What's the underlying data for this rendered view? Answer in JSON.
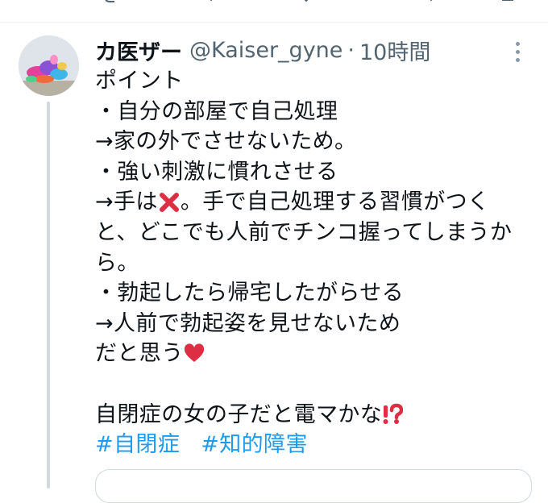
{
  "tweet": {
    "display_name": "カ医ザー",
    "handle": "@Kaiser_gyne",
    "separator": "·",
    "time": "10時間",
    "lines": {
      "l1": "ポイント",
      "l2": "・自分の部屋で自己処理",
      "l3": "→家の外でさせないため。",
      "l4": "・強い刺激に慣れさせる",
      "l5a": "→手は",
      "l5b": "。手で自己処理する習慣がつく",
      "l6": "と、どこでも人前でチンコ握ってしまうか",
      "l7": "ら。",
      "l8": "・勃起したら帰宅したがらせる",
      "l9": "→人前で勃起姿を見せないため",
      "l10": "だと思う",
      "l12": "自閉症の女の子だと電マかな"
    },
    "hashtags": [
      "#自閉症",
      "#知的障害"
    ],
    "icons": {
      "cross": "cross-mark-icon",
      "heart": "red-heart-icon",
      "exclaim": "exclamation-question-icon",
      "more": "more-options-icon"
    },
    "colors": {
      "accent": "#1d9bf0",
      "secondary_text": "#536471",
      "text": "#0f1419",
      "thread_line": "#cfd9de"
    }
  }
}
